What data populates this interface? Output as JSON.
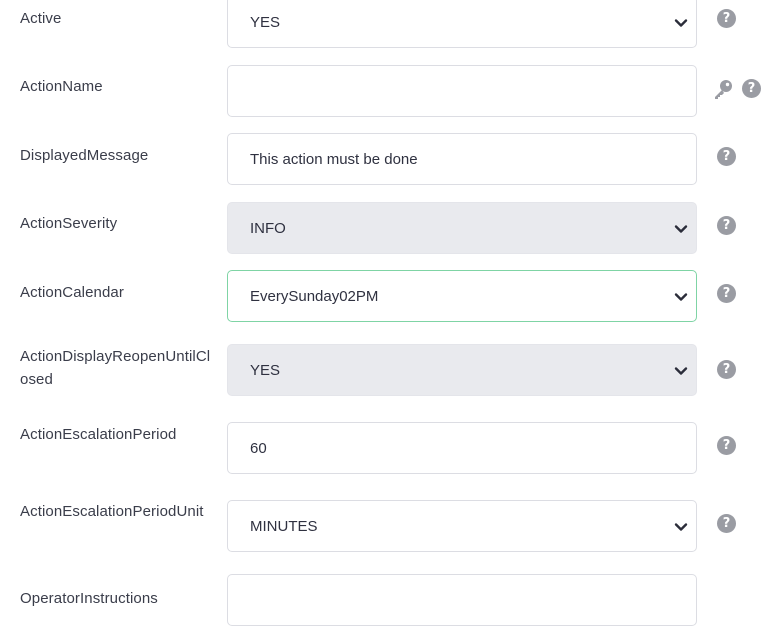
{
  "form": {
    "active": {
      "label": "Active",
      "value": "YES"
    },
    "action_name": {
      "label": "ActionName",
      "value": ""
    },
    "displayed_message": {
      "label": "DisplayedMessage",
      "value": "This action must be done"
    },
    "action_severity": {
      "label": "ActionSeverity",
      "value": "INFO"
    },
    "action_calendar": {
      "label": "ActionCalendar",
      "value": "EverySunday02PM"
    },
    "action_display_reopen": {
      "label": "ActionDisplayReopenUntilClosed",
      "value": "YES"
    },
    "action_escalation_period": {
      "label": "ActionEscalationPeriod",
      "value": "60"
    },
    "action_escalation_period_unit": {
      "label": "ActionEscalationPeriodUnit",
      "value": "MINUTES"
    },
    "operator_instructions": {
      "label": "OperatorInstructions",
      "value": ""
    }
  },
  "icons": {
    "help": "question-circle-icon",
    "key": "key-icon",
    "dropdown": "chevron-down-icon",
    "help_glyph": "?"
  },
  "colors": {
    "label_text": "#3a3d4a",
    "field_border": "#dcdde3",
    "disabled_bg": "#e9eaee",
    "focus_border": "#7fd4a5",
    "help_icon": "#9a9ca3"
  }
}
